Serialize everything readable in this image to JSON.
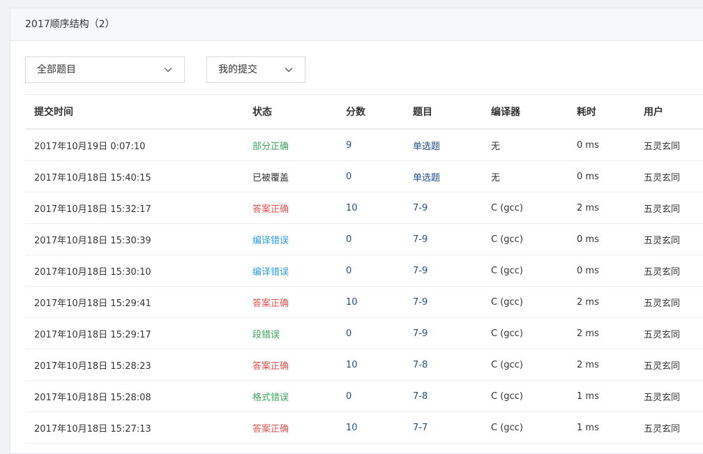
{
  "panel": {
    "title": "2017顺序结构（2）"
  },
  "filters": {
    "problem_select": "全部题目",
    "scope_select": "我的提交"
  },
  "table": {
    "headers": {
      "time": "提交时间",
      "status": "状态",
      "score": "分数",
      "problem": "题目",
      "compiler": "编译器",
      "elapsed": "耗时",
      "user": "用户"
    },
    "rows": [
      {
        "time": "2017年10月19日 0:07:10",
        "status": "部分正确",
        "status_color": "green",
        "score": "9",
        "problem": "单选题",
        "compiler": "无",
        "elapsed": "0 ms",
        "user": "五灵玄同"
      },
      {
        "time": "2017年10月18日 15:40:15",
        "status": "已被覆盖",
        "status_color": "black",
        "score": "0",
        "problem": "单选题",
        "compiler": "无",
        "elapsed": "0 ms",
        "user": "五灵玄同"
      },
      {
        "time": "2017年10月18日 15:32:17",
        "status": "答案正确",
        "status_color": "red",
        "score": "10",
        "problem": "7-9",
        "compiler": "C (gcc)",
        "elapsed": "2 ms",
        "user": "五灵玄同"
      },
      {
        "time": "2017年10月18日 15:30:39",
        "status": "编译错误",
        "status_color": "blue",
        "score": "0",
        "problem": "7-9",
        "compiler": "C (gcc)",
        "elapsed": "0 ms",
        "user": "五灵玄同"
      },
      {
        "time": "2017年10月18日 15:30:10",
        "status": "编译错误",
        "status_color": "blue",
        "score": "0",
        "problem": "7-9",
        "compiler": "C (gcc)",
        "elapsed": "0 ms",
        "user": "五灵玄同"
      },
      {
        "time": "2017年10月18日 15:29:41",
        "status": "答案正确",
        "status_color": "red",
        "score": "10",
        "problem": "7-9",
        "compiler": "C (gcc)",
        "elapsed": "2 ms",
        "user": "五灵玄同"
      },
      {
        "time": "2017年10月18日 15:29:17",
        "status": "段错误",
        "status_color": "green",
        "score": "0",
        "problem": "7-9",
        "compiler": "C (gcc)",
        "elapsed": "2 ms",
        "user": "五灵玄同"
      },
      {
        "time": "2017年10月18日 15:28:23",
        "status": "答案正确",
        "status_color": "red",
        "score": "10",
        "problem": "7-8",
        "compiler": "C (gcc)",
        "elapsed": "2 ms",
        "user": "五灵玄同"
      },
      {
        "time": "2017年10月18日 15:28:08",
        "status": "格式错误",
        "status_color": "green",
        "score": "0",
        "problem": "7-8",
        "compiler": "C (gcc)",
        "elapsed": "1 ms",
        "user": "五灵玄同"
      },
      {
        "time": "2017年10月18日 15:27:13",
        "status": "答案正确",
        "status_color": "red",
        "score": "10",
        "problem": "7-7",
        "compiler": "C (gcc)",
        "elapsed": "1 ms",
        "user": "五灵玄同"
      }
    ]
  },
  "icons": {
    "dropdown": "chevron-down-icon"
  },
  "colors": {
    "link": "#1e4f8a",
    "status_green": "#3aa55a",
    "status_red": "#e05252",
    "status_blue": "#2a9fd6"
  }
}
